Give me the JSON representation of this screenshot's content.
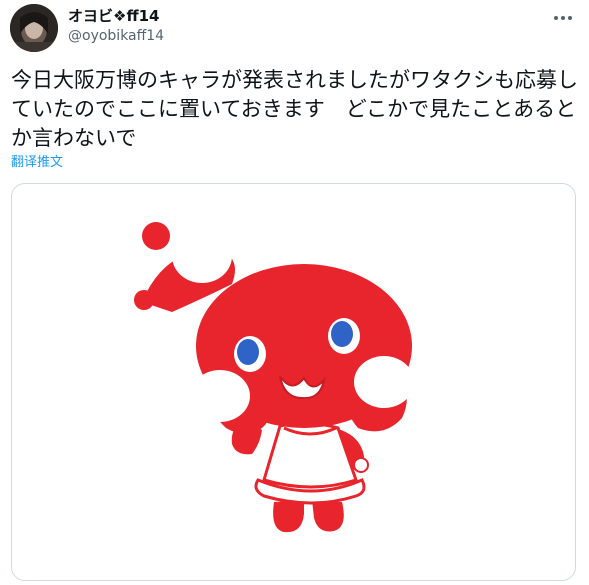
{
  "author": {
    "display_name": "オヨビ❖ff14",
    "handle": "@oyobikaff14"
  },
  "tweet": {
    "text": "今日大阪万博のキャラが発表されましたがワタクシも応募していたのでここに置いておきます　どこかで見たことあるとか言わないで",
    "translate_label": "翻译推文"
  },
  "icons": {
    "more": "more-dots-icon"
  },
  "colors": {
    "mascot_red": "#e8242c",
    "link_blue": "#1d9bf0",
    "eye_blue": "#2f63c8"
  }
}
